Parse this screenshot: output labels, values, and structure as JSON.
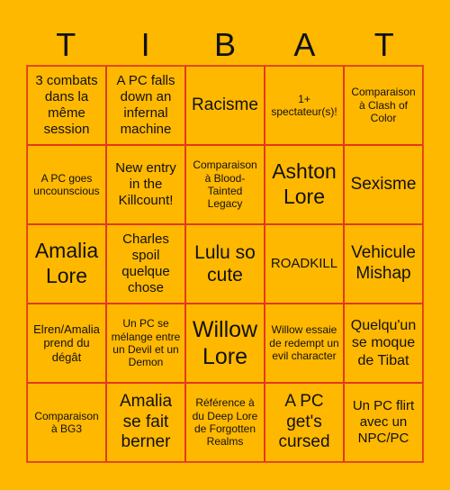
{
  "header": {
    "letters": [
      "T",
      "I",
      "B",
      "A",
      "T"
    ]
  },
  "board": {
    "cells": [
      "3 combats dans la même session",
      "A PC falls down an infernal machine",
      "Racisme",
      "1+ spectateur(s)!",
      "Comparaison à Clash of Color",
      "A PC goes uncounscious",
      "New entry in the Killcount!",
      "Comparaison à Blood-Tainted Legacy",
      "Ashton Lore",
      "Sexisme",
      "Amalia Lore",
      "Charles spoil quelque chose",
      "Lulu so cute",
      "ROADKILL",
      "Vehicule Mishap",
      "Elren/Amalia prend du dégât",
      "Un PC se mélange entre un Devil et un Demon",
      "Willow Lore",
      "Willow essaie de redempt un evil character",
      "Quelqu'un se moque de Tibat",
      "Comparaison à BG3",
      "Amalia se fait berner",
      "Référence à du Deep Lore de Forgotten Realms",
      "A PC get's cursed",
      "Un PC flirt avec un NPC/PC"
    ]
  },
  "colors": {
    "background": "#ffb800",
    "cell_border": "#e03a1a"
  }
}
